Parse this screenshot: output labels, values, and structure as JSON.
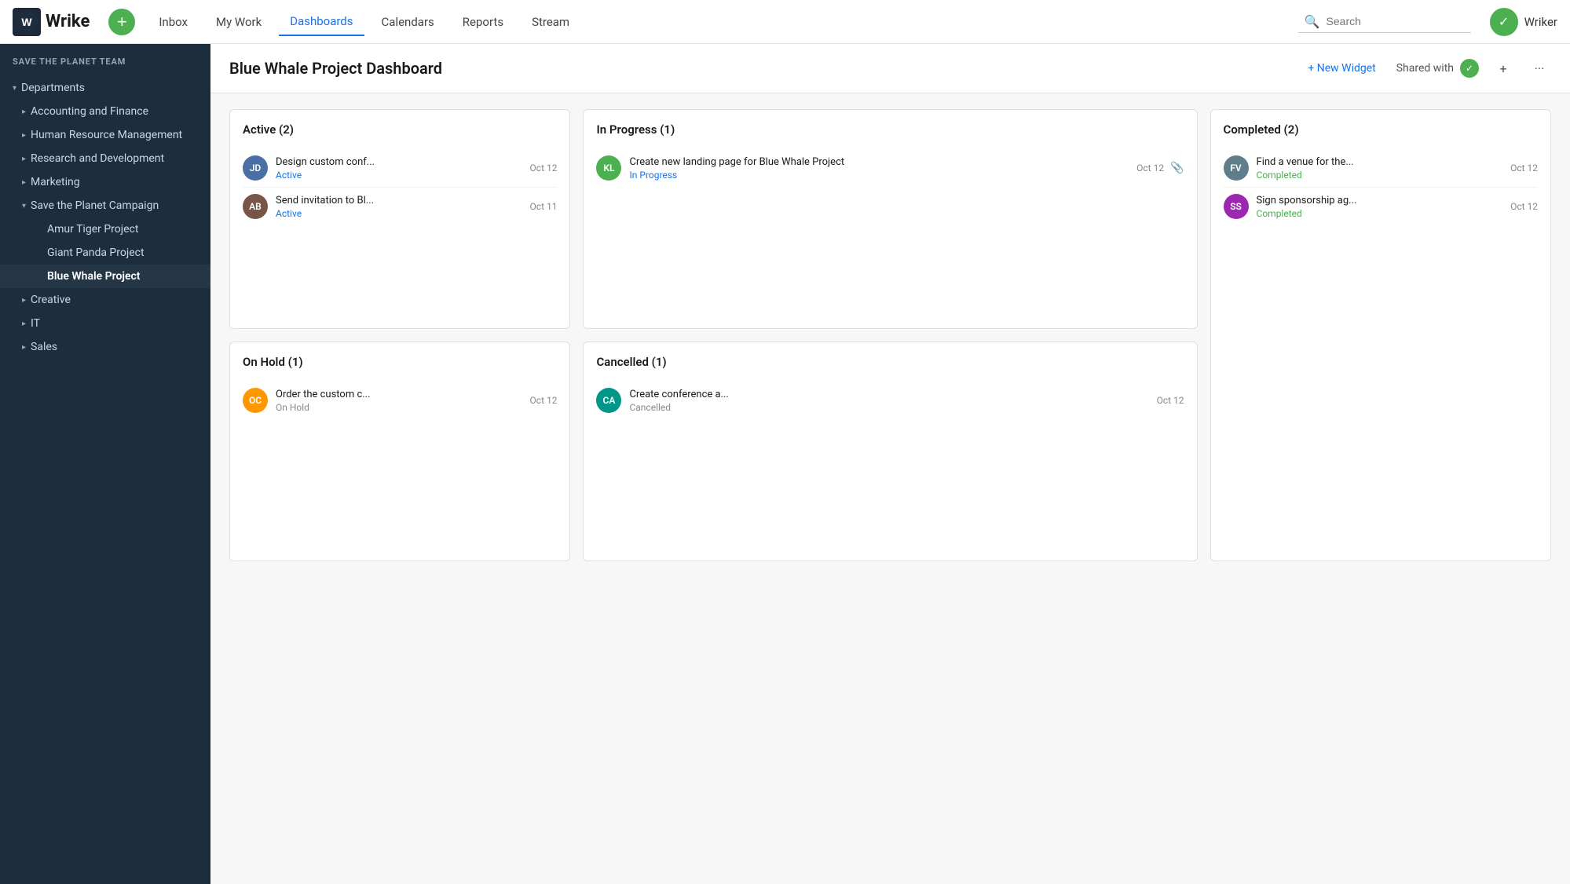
{
  "logo": {
    "text": "Wrike"
  },
  "nav": {
    "add_btn_label": "+",
    "items": [
      {
        "id": "inbox",
        "label": "Inbox",
        "active": false
      },
      {
        "id": "my-work",
        "label": "My Work",
        "active": false
      },
      {
        "id": "dashboards",
        "label": "Dashboards",
        "active": true
      },
      {
        "id": "calendars",
        "label": "Calendars",
        "active": false
      },
      {
        "id": "reports",
        "label": "Reports",
        "active": false
      },
      {
        "id": "stream",
        "label": "Stream",
        "active": false
      }
    ],
    "search_placeholder": "Search",
    "user_name": "Wriker"
  },
  "sidebar": {
    "team_label": "Save the Planet Team",
    "items": [
      {
        "id": "departments",
        "label": "Departments",
        "indent": 0,
        "chevron": "▾",
        "expanded": true
      },
      {
        "id": "accounting",
        "label": "Accounting and Finance",
        "indent": 1,
        "chevron": "▸"
      },
      {
        "id": "hr",
        "label": "Human Resource Management",
        "indent": 1,
        "chevron": "▸"
      },
      {
        "id": "rd",
        "label": "Research and Development",
        "indent": 1,
        "chevron": "▸"
      },
      {
        "id": "marketing",
        "label": "Marketing",
        "indent": 1,
        "chevron": "▸"
      },
      {
        "id": "save-planet",
        "label": "Save the Planet Campaign",
        "indent": 1,
        "chevron": "▾",
        "expanded": true
      },
      {
        "id": "amur-tiger",
        "label": "Amur Tiger Project",
        "indent": 3
      },
      {
        "id": "giant-panda",
        "label": "Giant Panda Project",
        "indent": 3
      },
      {
        "id": "blue-whale",
        "label": "Blue Whale Project",
        "indent": 3,
        "active": true
      },
      {
        "id": "creative",
        "label": "Creative",
        "indent": 1,
        "chevron": "▸"
      },
      {
        "id": "it",
        "label": "IT",
        "indent": 1,
        "chevron": "▸"
      },
      {
        "id": "sales",
        "label": "Sales",
        "indent": 1,
        "chevron": "▸"
      }
    ]
  },
  "page": {
    "title": "Blue Whale Project Dashboard",
    "new_widget_label": "+ New Widget",
    "shared_with_label": "Shared with"
  },
  "widgets": {
    "active": {
      "title": "Active (2)",
      "tasks": [
        {
          "id": "t1",
          "name": "Design custom conf...",
          "status": "Active",
          "status_type": "active",
          "date": "Oct 12",
          "avatar": "blue"
        },
        {
          "id": "t2",
          "name": "Send invitation to Bl...",
          "status": "Active",
          "status_type": "active",
          "date": "Oct 11",
          "avatar": "brown"
        }
      ]
    },
    "in_progress": {
      "title": "In Progress (1)",
      "tasks": [
        {
          "id": "t3",
          "name": "Create new landing page for Blue Whale Project",
          "status": "In Progress",
          "status_type": "in-progress",
          "date": "Oct 12",
          "avatar": "green"
        }
      ]
    },
    "completed": {
      "title": "Completed (2)",
      "tasks": [
        {
          "id": "t4",
          "name": "Find a venue for the...",
          "status": "Completed",
          "status_type": "completed",
          "date": "Oct 12",
          "avatar": "gray"
        },
        {
          "id": "t5",
          "name": "Sign sponsorship ag...",
          "status": "Completed",
          "status_type": "completed",
          "date": "Oct 12",
          "avatar": "purple"
        }
      ]
    },
    "on_hold": {
      "title": "On Hold (1)",
      "tasks": [
        {
          "id": "t6",
          "name": "Order the custom c...",
          "status": "On Hold",
          "status_type": "on-hold",
          "date": "Oct 12",
          "avatar": "orange"
        }
      ]
    },
    "cancelled": {
      "title": "Cancelled (1)",
      "tasks": [
        {
          "id": "t7",
          "name": "Create conference a...",
          "status": "Cancelled",
          "status_type": "cancelled",
          "date": "Oct 12",
          "avatar": "teal"
        }
      ]
    }
  }
}
